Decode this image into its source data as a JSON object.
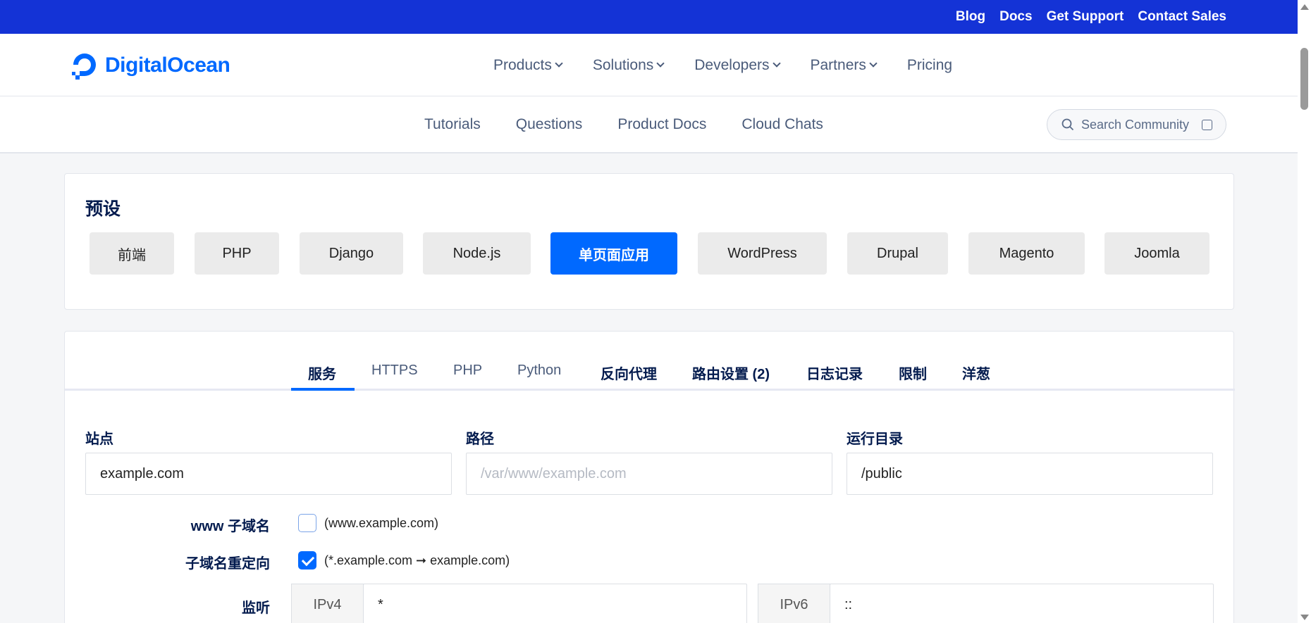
{
  "topbar": {
    "links": [
      "Blog",
      "Docs",
      "Get Support",
      "Contact Sales"
    ]
  },
  "brand": {
    "name": "DigitalOcean",
    "color": "#0069ff"
  },
  "mainnav": {
    "items": [
      {
        "label": "Products",
        "dropdown": true
      },
      {
        "label": "Solutions",
        "dropdown": true
      },
      {
        "label": "Developers",
        "dropdown": true
      },
      {
        "label": "Partners",
        "dropdown": true
      },
      {
        "label": "Pricing",
        "dropdown": false
      }
    ]
  },
  "subnav": {
    "items": [
      "Tutorials",
      "Questions",
      "Product Docs",
      "Cloud Chats"
    ],
    "search_placeholder": "Search Community"
  },
  "presets": {
    "title": "预设",
    "items": [
      "前端",
      "PHP",
      "Django",
      "Node.js",
      "单页面应用",
      "WordPress",
      "Drupal",
      "Magento",
      "Joomla"
    ],
    "active": "单页面应用"
  },
  "tabs": {
    "items": [
      "服务",
      "HTTPS",
      "PHP",
      "Python",
      "反向代理",
      "路由设置 (2)",
      "日志记录",
      "限制",
      "洋葱"
    ],
    "active": "服务"
  },
  "form": {
    "site": {
      "label": "站点",
      "value": "example.com"
    },
    "path": {
      "label": "路径",
      "placeholder": "/var/www/example.com"
    },
    "docroot": {
      "label": "运行目录",
      "value": "/public"
    },
    "www_subdomain": {
      "label": "www 子域名",
      "desc": "(www.example.com)",
      "checked": false
    },
    "subdomain_redirect": {
      "label": "子域名重定向",
      "desc": "(*.example.com ➞ example.com)",
      "checked": true
    },
    "listen": {
      "label": "监听",
      "ipv4_label": "IPv4",
      "ipv4_value": "*",
      "ipv6_label": "IPv6",
      "ipv6_value": "::"
    }
  },
  "colors": {
    "topbar": "#1433d6",
    "accent": "#0069ff"
  }
}
